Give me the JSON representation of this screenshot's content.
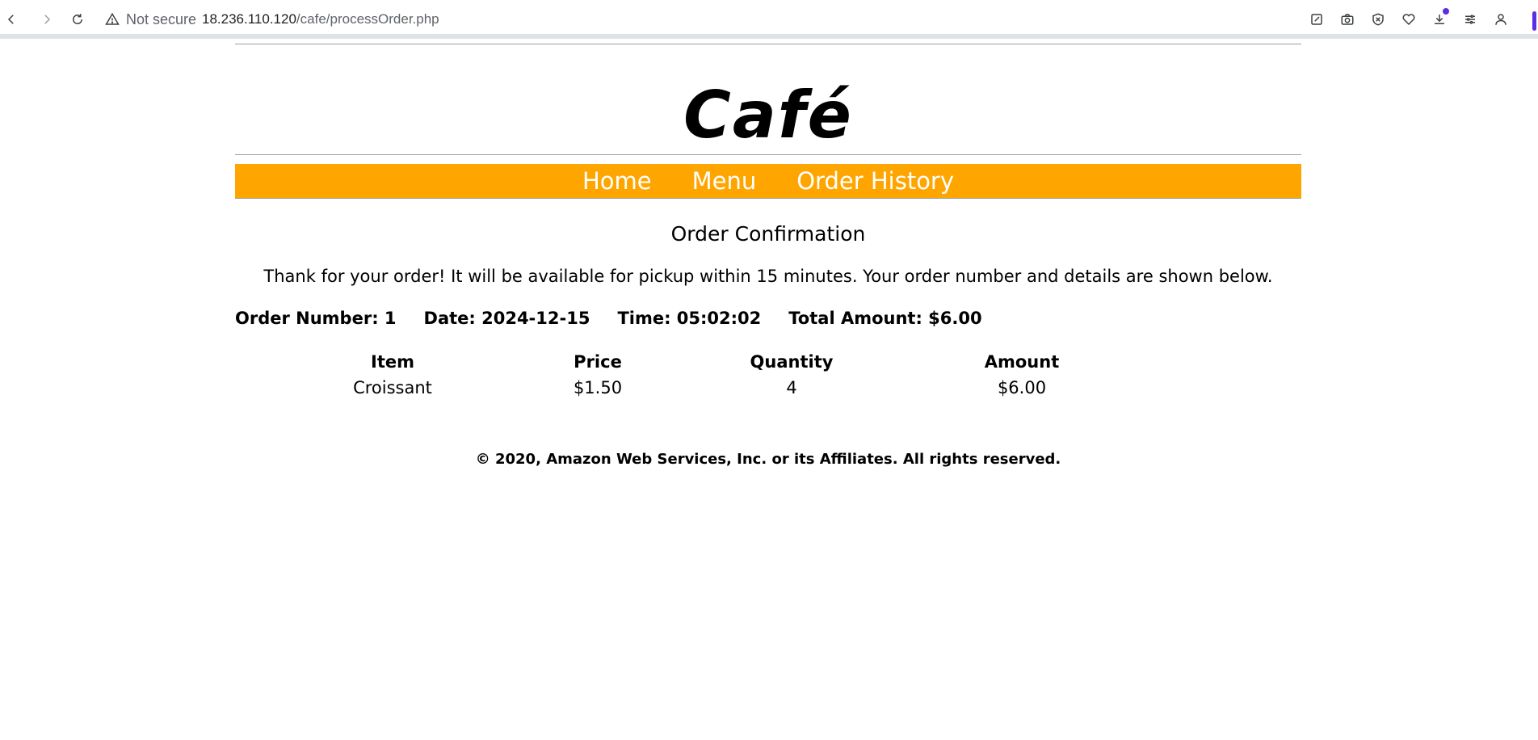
{
  "browser": {
    "security_label": "Not secure",
    "url_host": "18.236.110.120",
    "url_path": "/cafe/processOrder.php",
    "download_dot_color": "#5b2ee6",
    "accent_color": "#5b2ee6"
  },
  "site": {
    "title": "Café",
    "nav_color": "#ffa500",
    "nav": [
      {
        "label": "Home"
      },
      {
        "label": "Menu"
      },
      {
        "label": "Order History"
      }
    ]
  },
  "confirmation": {
    "heading": "Order Confirmation",
    "message": "Thank for your order! It will be available for pickup within 15 minutes. Your order number and details are shown below.",
    "order_number": "Order Number: 1",
    "date": "Date: 2024-12-15",
    "time": "Time: 05:02:02",
    "total": "Total Amount: $6.00"
  },
  "order_table": {
    "headers": [
      "Item",
      "Price",
      "Quantity",
      "Amount"
    ],
    "rows": [
      [
        "Croissant",
        "$1.50",
        "4",
        "$6.00"
      ]
    ]
  },
  "footer": {
    "text": "© 2020, Amazon Web Services, Inc. or its Affiliates. All rights reserved."
  }
}
